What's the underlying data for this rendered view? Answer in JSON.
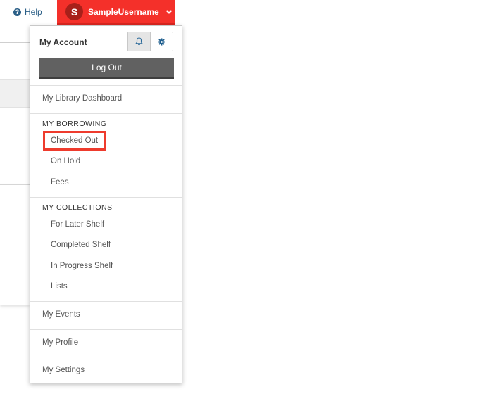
{
  "topbar": {
    "help_label": "Help",
    "avatar_initial": "S",
    "username": "SampleUsername"
  },
  "colors": {
    "brand_red": "#f4302a",
    "logout_gray": "#616161",
    "link_blue": "#2b5f87",
    "highlight_red": "#ee3b2d"
  },
  "dropdown": {
    "title": "My Account",
    "logout_label": "Log Out",
    "dashboard_label": "My Library Dashboard",
    "borrowing": {
      "heading": "MY BORROWING",
      "items": [
        "Checked Out",
        "On Hold",
        "Fees"
      ]
    },
    "collections": {
      "heading": "MY COLLECTIONS",
      "items": [
        "For Later Shelf",
        "Completed Shelf",
        "In Progress Shelf",
        "Lists"
      ]
    },
    "events_label": "My Events",
    "profile_label": "My Profile",
    "settings_label": "My Settings"
  },
  "icons": [
    "help-icon",
    "chevron-down-icon",
    "bell-icon",
    "gear-icon"
  ]
}
